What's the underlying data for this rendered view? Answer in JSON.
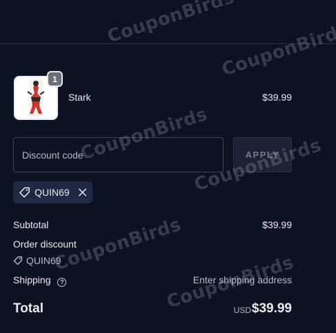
{
  "line_item": {
    "quantity": "1",
    "name": "Stark",
    "price": "$39.99"
  },
  "discount": {
    "placeholder": "Discount code",
    "apply_label": "APPLY",
    "applied_code": "QUIN69"
  },
  "summary": {
    "subtotal_label": "Subtotal",
    "subtotal_value": "$39.99",
    "order_discount_label": "Order discount",
    "order_discount_code": "QUIN69",
    "shipping_label": "Shipping",
    "shipping_help": "?",
    "shipping_value": "Enter shipping address",
    "total_label": "Total",
    "total_currency": "USD",
    "total_value": "$39.99"
  },
  "watermark": {
    "text": "CouponBirds"
  },
  "colors": {
    "background": "#0c1221",
    "chip": "#1c2a44",
    "text": "#e8ebf2"
  }
}
